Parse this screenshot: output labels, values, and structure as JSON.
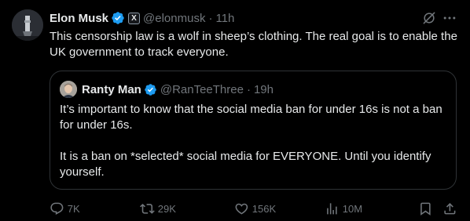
{
  "tweet": {
    "author_name": "Elon Musk",
    "gov_badge": "X",
    "handle": "@elonmusk",
    "separator": "·",
    "time": "11h",
    "text": "This censorship law is a wolf in sheep’s clothing. The real goal is to enable the UK government to track everyone."
  },
  "quote": {
    "author_name": "Ranty Man",
    "handle": "@RanTeeThree",
    "separator": "·",
    "time": "19h",
    "paragraph1": "It’s important to know that the social media ban for under 16s is not a ban for under 16s.",
    "paragraph2": "It is a ban on *selected* social media for EVERYONE. Until you identify yourself."
  },
  "actions": {
    "replies": "7K",
    "reposts": "29K",
    "likes": "156K",
    "views": "10M"
  },
  "icons": {
    "verified": "verified-badge-icon",
    "grok": "grok-icon",
    "more": "more-icon",
    "reply": "reply-icon",
    "repost": "repost-icon",
    "like": "heart-icon",
    "views": "views-icon",
    "bookmark": "bookmark-icon",
    "share": "share-icon"
  },
  "colors": {
    "background": "#000000",
    "text": "#e7e9ea",
    "secondary": "#71767b",
    "verified_blue": "#1d9bf0",
    "border": "#2f3336"
  }
}
